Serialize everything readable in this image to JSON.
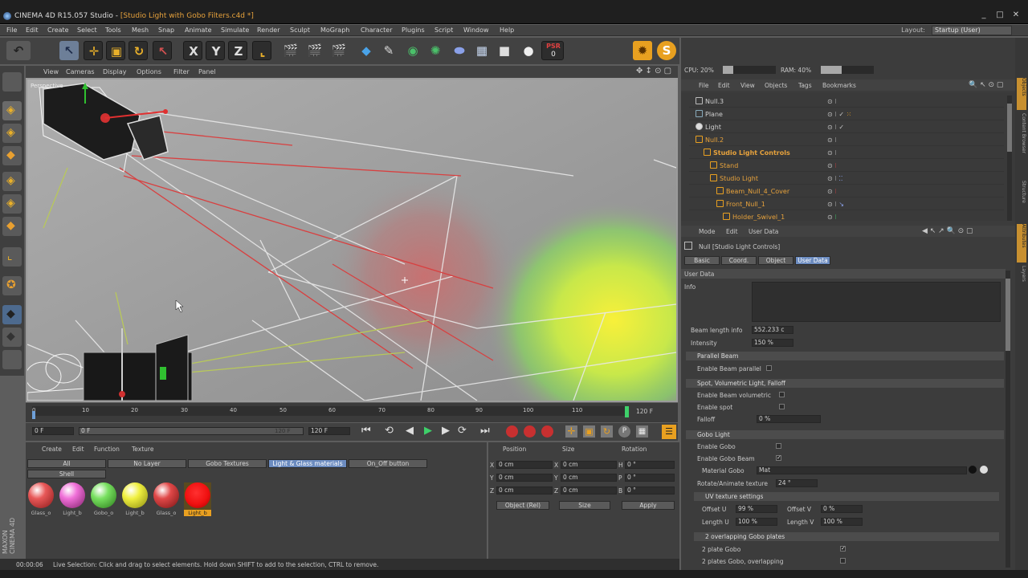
{
  "window": {
    "title_prefix": "CINEMA 4D R15.057 Studio - ",
    "title_doc": "[Studio Light with Gobo Filters.c4d *]",
    "minimize": "_",
    "maximize": "□",
    "close": "✕"
  },
  "menu": [
    "File",
    "Edit",
    "Create",
    "Select",
    "Tools",
    "Mesh",
    "Snap",
    "Animate",
    "Simulate",
    "Render",
    "Sculpt",
    "MoGraph",
    "Character",
    "Plugins",
    "Script",
    "Window",
    "Help"
  ],
  "layout": {
    "label": "Layout:",
    "value": "Startup (User)"
  },
  "toolbar": {
    "x": "X",
    "y": "Y",
    "z": "Z",
    "psr": "PSR",
    "psr_val": "0"
  },
  "viewport": {
    "menus": [
      "View",
      "Cameras",
      "Display",
      "Options",
      "Filter",
      "Panel"
    ],
    "label": "Perspective"
  },
  "timeline": {
    "ticks": [
      "0",
      "10",
      "20",
      "30",
      "40",
      "50",
      "60",
      "70",
      "80",
      "90",
      "100",
      "110"
    ],
    "end_frame": "120 F"
  },
  "transport": {
    "cur_frame": "0 F",
    "range_start": "0 F",
    "range_end": "120 F",
    "max_frame": "120 F"
  },
  "materials": {
    "menu": [
      "Create",
      "Edit",
      "Function",
      "Texture"
    ],
    "layers": [
      "All",
      "No Layer",
      "Gobo Textures",
      "Light & Glass materials",
      "On_Off button"
    ],
    "shell_label": "Shell",
    "items": [
      {
        "name": "Glass_o",
        "color": "#e85858"
      },
      {
        "name": "Light_b",
        "color": "#f070d8"
      },
      {
        "name": "Gobo_o",
        "color": "#78e060"
      },
      {
        "name": "Light_b",
        "color": "#f0f040"
      },
      {
        "name": "Glass_o",
        "color": "#e04848"
      },
      {
        "name": "Light_b",
        "color": "#f01010"
      }
    ]
  },
  "coords": {
    "headers": [
      "Position",
      "Size",
      "Rotation"
    ],
    "rows": [
      {
        "axis": "X",
        "pos": "0 cm",
        "size_axis": "X",
        "size": "0 cm",
        "rot_axis": "H",
        "rot": "0 °"
      },
      {
        "axis": "Y",
        "pos": "0 cm",
        "size_axis": "Y",
        "size": "0 cm",
        "rot_axis": "P",
        "rot": "0 °"
      },
      {
        "axis": "Z",
        "pos": "0 cm",
        "size_axis": "Z",
        "size": "0 cm",
        "rot_axis": "B",
        "rot": "0 °"
      }
    ],
    "mode": "Object (Rel)",
    "size_mode": "Size",
    "apply": "Apply"
  },
  "status": {
    "time": "00:00:06",
    "text": "Live Selection: Click and drag to select elements. Hold down SHIFT to add to the selection, CTRL to remove."
  },
  "monitor": {
    "cpu": "CPU: 20%",
    "ram": "RAM: 40%",
    "cpu_frac": 0.2,
    "ram_frac": 0.4
  },
  "objects": {
    "menu": [
      "File",
      "Edit",
      "View",
      "Objects",
      "Tags",
      "Bookmarks"
    ],
    "rows": [
      {
        "name": "Null.3",
        "indent": 0,
        "color": "#cfcfcf"
      },
      {
        "name": "Plane",
        "indent": 0,
        "color": "#cfcfcf"
      },
      {
        "name": "Light",
        "indent": 0,
        "color": "#cfcfcf"
      },
      {
        "name": "Null.2",
        "indent": 0,
        "color": "#e7a23c"
      },
      {
        "name": "Studio Light Controls",
        "indent": 1,
        "color": "#e7a23c"
      },
      {
        "name": "Stand",
        "indent": 2,
        "color": "#e7a23c"
      },
      {
        "name": "Studio Light",
        "indent": 2,
        "color": "#e7a23c"
      },
      {
        "name": "Beam_Null_4_Cover",
        "indent": 3,
        "color": "#e7a23c"
      },
      {
        "name": "Front_Null_1",
        "indent": 3,
        "color": "#e7a23c"
      },
      {
        "name": "Holder_Swivel_1",
        "indent": 4,
        "color": "#e7a23c"
      }
    ]
  },
  "attributes": {
    "menu": [
      "Mode",
      "Edit",
      "User Data"
    ],
    "object_title": "Null [Studio Light Controls]",
    "tabs": [
      "Basic",
      "Coord.",
      "Object",
      "User Data"
    ],
    "active_tab": "User Data",
    "section_title": "User Data",
    "info_label": "Info",
    "beam_length": {
      "label": "Beam length info",
      "value": "552.233 c"
    },
    "intensity": {
      "label": "Intensity",
      "value": "150 %"
    },
    "parallel_beam": {
      "title": "Parallel Beam",
      "enable": "Enable Beam parallel"
    },
    "spot": {
      "title": "Spot, Volumetric Light, Falloff",
      "volumetric": "Enable Beam volumetric",
      "spot": "Enable spot",
      "falloff": "Falloff",
      "falloff_value": "0 %"
    },
    "gobo": {
      "title": "Gobo Light",
      "enable": "Enable Gobo",
      "enable_beam": "Enable Gobo Beam",
      "material_label": "Material Gobo",
      "material_value": "Mat",
      "rotate_label": "Rotate/Animate texture",
      "rotate_value": "24 °"
    },
    "uv": {
      "title": "UV texture settings",
      "offset_u": "Offset U",
      "offset_u_val": "99 %",
      "offset_v": "Offset V",
      "offset_v_val": "0 %",
      "length_u": "Length U",
      "length_u_val": "100 %",
      "length_v": "Length V",
      "length_v_val": "100 %"
    },
    "overlap": {
      "title": "2 overlapping Gobo plates",
      "two_plates": "2 plate Gobo",
      "overlapping": "2 plates Gobo, overlapping"
    }
  },
  "sidetabs": [
    "Objects",
    "Content Browser",
    "Structure",
    "Attributes",
    "Layers"
  ]
}
